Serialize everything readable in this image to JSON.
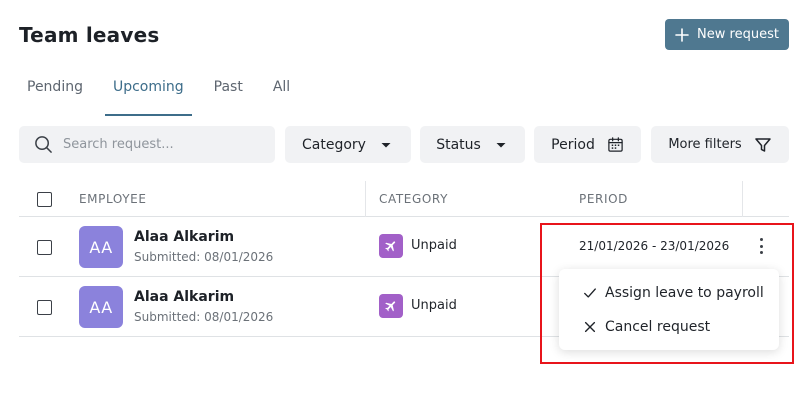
{
  "header": {
    "title": "Team leaves",
    "new_request_label": "New request"
  },
  "tabs": [
    {
      "label": "Pending",
      "active": false
    },
    {
      "label": "Upcoming",
      "active": true
    },
    {
      "label": "Past",
      "active": false
    },
    {
      "label": "All",
      "active": false
    }
  ],
  "filters": {
    "search_placeholder": "Search request...",
    "search_value": "",
    "category_label": "Category",
    "status_label": "Status",
    "period_label": "Period",
    "more_filters_label": "More filters"
  },
  "table": {
    "columns": {
      "employee": "EMPLOYEE",
      "category": "CATEGORY",
      "period": "PERIOD"
    },
    "rows": [
      {
        "initials": "AA",
        "name": "Alaa Alkarim",
        "submitted": "Submitted: 08/01/2026",
        "category": "Unpaid",
        "period": "21/01/2026 - 23/01/2026"
      },
      {
        "initials": "AA",
        "name": "Alaa Alkarim",
        "submitted": "Submitted: 08/01/2026",
        "category": "Unpaid",
        "period": ""
      }
    ]
  },
  "row_menu": {
    "items": [
      {
        "label": "Assign leave to payroll",
        "icon": "check-icon"
      },
      {
        "label": "Cancel request",
        "icon": "x-icon"
      }
    ]
  },
  "colors": {
    "primary_button": "#4f7890",
    "active_tab": "#3d6d8a",
    "avatar": "#8b82dc",
    "category_unpaid": "#a260c8",
    "highlight": "#e8141b"
  }
}
